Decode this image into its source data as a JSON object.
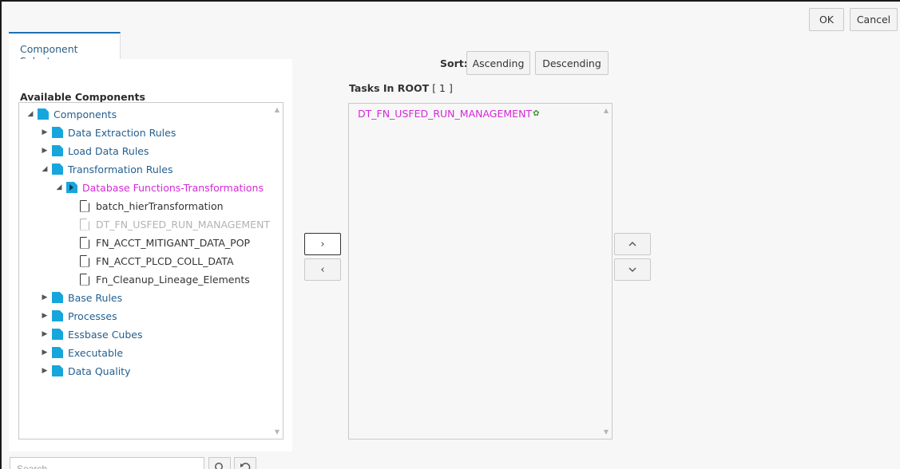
{
  "header": {
    "ok_label": "OK",
    "cancel_label": "Cancel"
  },
  "tabs": [
    {
      "label": "Component Selector"
    }
  ],
  "left_panel": {
    "title": "Available Components",
    "tree": [
      {
        "label": "Components",
        "expanded": true,
        "icon": "folder-icon"
      },
      {
        "label": "Data Extraction Rules",
        "expanded": false,
        "icon": "folder-icon"
      },
      {
        "label": "Load Data Rules",
        "expanded": false,
        "icon": "folder-icon"
      },
      {
        "label": "Transformation Rules",
        "expanded": true,
        "icon": "folder-icon"
      },
      {
        "label": "Database Functions-Transformations",
        "expanded": true,
        "icon": "folder-icon",
        "selected": true
      },
      {
        "label": "batch_hierTransformation",
        "icon": "document-icon"
      },
      {
        "label": "DT_FN_USFED_RUN_MANAGEMENT",
        "icon": "document-icon",
        "disabled": true
      },
      {
        "label": "FN_ACCT_MITIGANT_DATA_POP",
        "icon": "document-icon"
      },
      {
        "label": "FN_ACCT_PLCD_COLL_DATA",
        "icon": "document-icon"
      },
      {
        "label": "Fn_Cleanup_Lineage_Elements",
        "icon": "document-icon"
      },
      {
        "label": "Base Rules",
        "expanded": false,
        "icon": "folder-icon"
      },
      {
        "label": "Processes",
        "expanded": false,
        "icon": "folder-icon"
      },
      {
        "label": "Essbase Cubes",
        "expanded": false,
        "icon": "folder-icon"
      },
      {
        "label": "Executable",
        "expanded": false,
        "icon": "folder-icon"
      },
      {
        "label": "Data Quality",
        "expanded": false,
        "icon": "folder-icon"
      }
    ],
    "search_placeholder": "Search"
  },
  "sort": {
    "label": "Sort:",
    "ascending_label": "Ascending",
    "descending_label": "Descending"
  },
  "tasks": {
    "title": "Tasks In ROOT",
    "count": "[ 1 ]",
    "items": [
      "DT_FN_USFED_RUN_MANAGEMENT"
    ]
  },
  "colors": {
    "accent": "#1f6fb2",
    "folder": "#17a6dc",
    "selected_text": "#d42ad6",
    "link_text": "#245f8f"
  }
}
